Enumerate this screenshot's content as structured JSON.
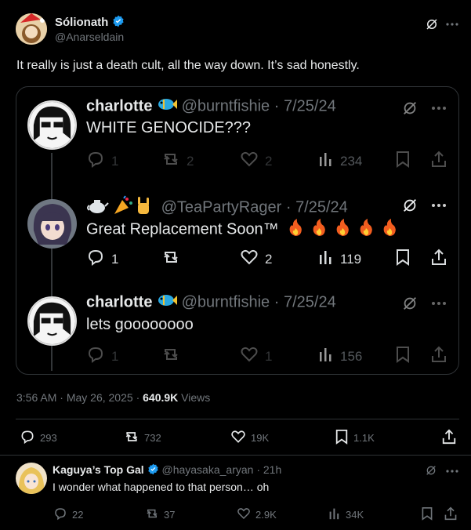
{
  "main_post": {
    "display_name": "Sólionath",
    "handle": "@Anarseldain",
    "text": "It really is just a death cult, all the way down. It’s sad honestly.",
    "time": "3:56 AM",
    "date": "May 26, 2025",
    "views_count": "640.9K",
    "views_label": "Views",
    "stats": {
      "replies": "293",
      "reposts": "732",
      "likes": "19K",
      "bookmarks": "1.1K"
    }
  },
  "quoted_thread": [
    {
      "display_name": "charlotte",
      "handle": "@burntfishie",
      "date": "7/25/24",
      "text": "WHITE GENOCIDE???",
      "stats": {
        "replies": "1",
        "reposts": "2",
        "likes": "2",
        "views": "234"
      },
      "dimmed": true
    },
    {
      "display_name": "",
      "handle": "@TeaPartyRager",
      "date": "7/25/24",
      "text": "Great Replacement Soon™",
      "stats": {
        "replies": "1",
        "reposts": "",
        "likes": "2",
        "views": "119"
      },
      "dimmed": false
    },
    {
      "display_name": "charlotte",
      "handle": "@burntfishie",
      "date": "7/25/24",
      "text": "lets goooooooo",
      "stats": {
        "replies": "1",
        "reposts": "",
        "likes": "1",
        "views": "156"
      },
      "dimmed": true
    }
  ],
  "reply": {
    "display_name": "Kaguya’s Top Gal",
    "handle": "@hayasaka_aryan",
    "time_ago": "21h",
    "separator": "·",
    "text": "I wonder what happened to that person… oh",
    "stats": {
      "replies": "22",
      "reposts": "37",
      "likes": "2.9K",
      "views": "34K"
    }
  },
  "colors": {
    "background": "#000000",
    "text": "#e7e9ea",
    "muted": "#71767b",
    "verified": "#1d9bf0",
    "border": "#2f3336"
  },
  "icons": [
    "grok-icon",
    "more-icon",
    "reply-icon",
    "repost-icon",
    "like-icon",
    "views-icon",
    "bookmark-icon",
    "share-icon",
    "verified-badge-icon"
  ]
}
